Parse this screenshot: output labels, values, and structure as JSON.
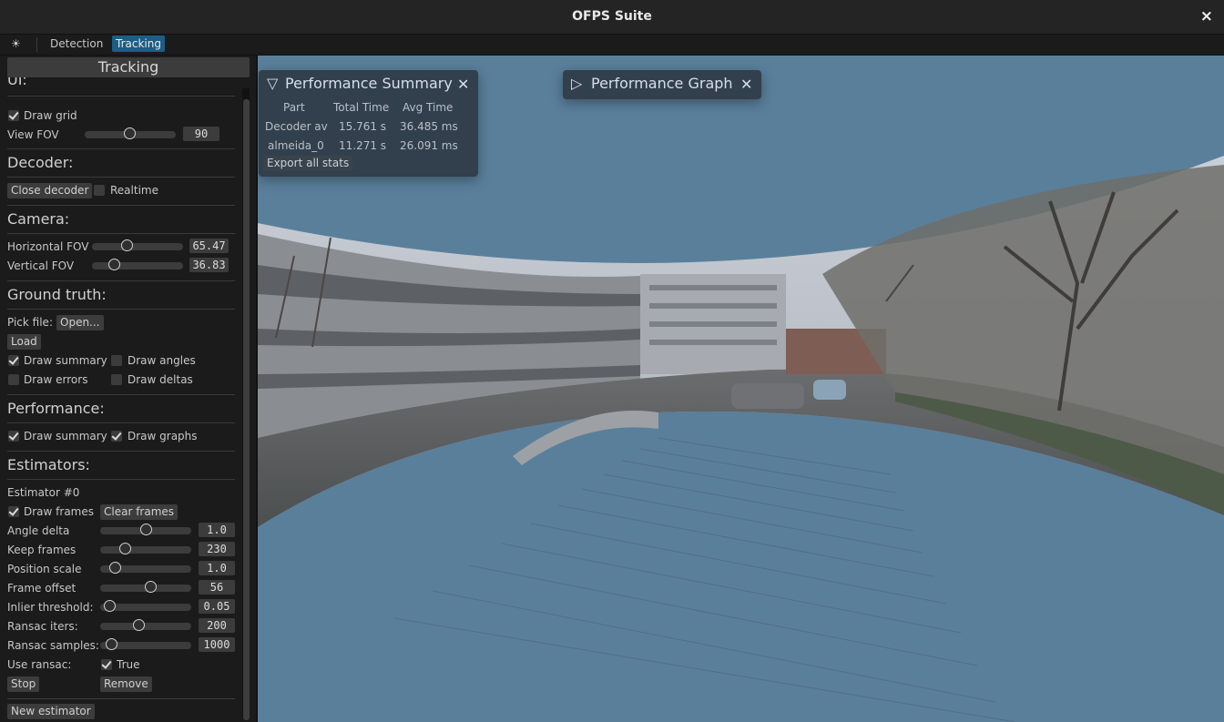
{
  "titlebar": {
    "title": "OFPS Suite",
    "close": "×"
  },
  "menubar": {
    "sun": "☀",
    "items": [
      "Detection",
      "Tracking"
    ],
    "active": "Tracking"
  },
  "panel": {
    "title": "Tracking",
    "ui": {
      "heading": "UI:",
      "draw_grid": {
        "label": "Draw grid",
        "checked": true
      },
      "view_fov": {
        "label": "View FOV",
        "value": "90",
        "fraction": 0.5
      }
    },
    "decoder": {
      "heading": "Decoder:",
      "close_button": "Close decoder",
      "realtime": {
        "label": "Realtime",
        "checked": false
      }
    },
    "camera": {
      "heading": "Camera:",
      "horizontal_fov": {
        "label": "Horizontal FOV",
        "value": "65.47",
        "fraction": 0.38
      },
      "vertical_fov": {
        "label": "Vertical FOV",
        "value": "36.83",
        "fraction": 0.25
      }
    },
    "ground_truth": {
      "heading": "Ground truth:",
      "pick_file_label": "Pick file:",
      "open_button": "Open...",
      "load_button": "Load",
      "draw_summary": {
        "label": "Draw summary",
        "checked": true
      },
      "draw_angles": {
        "label": "Draw angles",
        "checked": false
      },
      "draw_errors": {
        "label": "Draw errors",
        "checked": false
      },
      "draw_deltas": {
        "label": "Draw deltas",
        "checked": false
      }
    },
    "performance": {
      "heading": "Performance:",
      "draw_summary": {
        "label": "Draw summary",
        "checked": true
      },
      "draw_graphs": {
        "label": "Draw graphs",
        "checked": true
      }
    },
    "estimators": {
      "heading": "Estimators:",
      "estimator_label": "Estimator #0",
      "draw_frames": {
        "label": "Draw frames",
        "checked": true
      },
      "clear_frames_button": "Clear frames",
      "sliders": [
        {
          "label": "Angle delta",
          "value": "1.0",
          "fraction": 0.5
        },
        {
          "label": "Keep frames",
          "value": "230",
          "fraction": 0.27
        },
        {
          "label": "Position scale",
          "value": "1.0",
          "fraction": 0.16
        },
        {
          "label": "Frame offset",
          "value": "56",
          "fraction": 0.55
        },
        {
          "label": "Inlier threshold:",
          "value": "0.05",
          "fraction": 0.1
        },
        {
          "label": "Ransac iters:",
          "value": "200",
          "fraction": 0.42
        },
        {
          "label": "Ransac samples:",
          "value": "1000",
          "fraction": 0.12
        }
      ],
      "use_ransac": {
        "label": "Use ransac:",
        "checkbox_label": "True",
        "checked": true
      },
      "stop_button": "Stop",
      "remove_button": "Remove",
      "new_estimator_button": "New estimator"
    }
  },
  "perf_summary": {
    "toggle": "▽",
    "title": "Performance Summary",
    "close": "✕",
    "columns": [
      "Part",
      "Total Time",
      "Avg Time"
    ],
    "rows": [
      [
        "Decoder av",
        "15.761 s",
        "36.485 ms"
      ],
      [
        "almeida_0",
        "11.271 s",
        "26.091 ms"
      ]
    ],
    "export_button": "Export all stats"
  },
  "perf_graph": {
    "toggle": "▷",
    "title": "Performance Graph",
    "close": "✕"
  },
  "colors": {
    "accent": "#1c5e83",
    "background": "#5a7f9b",
    "panel": "#1b1b1b"
  }
}
